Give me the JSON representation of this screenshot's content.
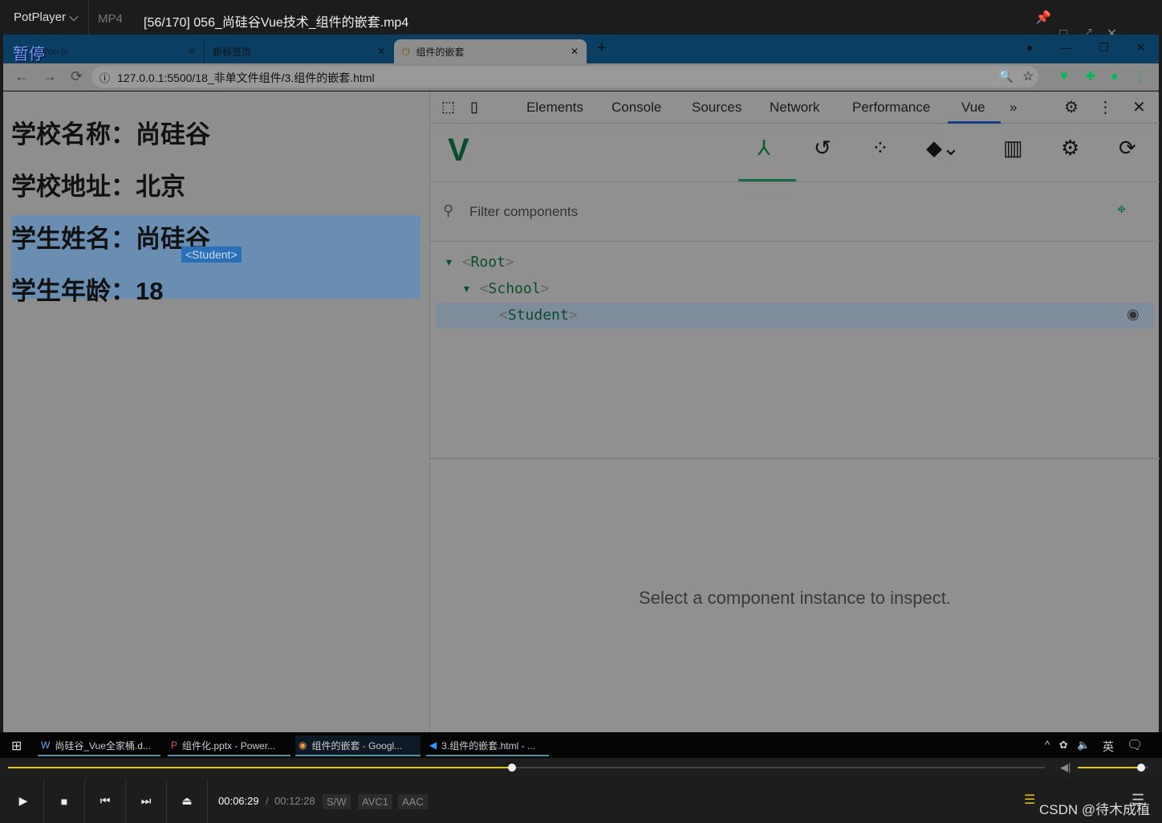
{
  "player": {
    "name": "PotPlayer",
    "format": "MP4",
    "title": "[56/170] 056_尚硅谷Vue技术_组件的嵌套.mp4",
    "pause_osd": "暂停",
    "time_current": "00:06:29",
    "time_sep": "/",
    "time_total": "00:12:28",
    "badges": [
      "S/W",
      "AVC1",
      "AAC"
    ],
    "progress_pct": 48.6,
    "volume_pct": 90,
    "watermark": "CSDN @待木成植"
  },
  "browser": {
    "tabs": [
      {
        "label": "Vue.js"
      },
      {
        "label": "新标签页"
      },
      {
        "label": "组件的嵌套",
        "active": true
      }
    ],
    "url": "127.0.0.1:5500/18_非单文件组件/3.组件的嵌套.html"
  },
  "page": {
    "lines": [
      "学校名称：尚硅谷",
      "学校地址：北京",
      "学生姓名：尚硅谷",
      "学生年龄：18"
    ],
    "tooltip": "<Student>"
  },
  "devtools": {
    "tabs": [
      "Elements",
      "Console",
      "Sources",
      "Network",
      "Performance",
      "Vue"
    ],
    "active_tab": "Vue",
    "filter_placeholder": "Filter components",
    "tree": [
      {
        "name": "Root",
        "depth": 0
      },
      {
        "name": "School",
        "depth": 1
      },
      {
        "name": "Student",
        "depth": 2,
        "selected": true
      }
    ],
    "empty_message": "Select a component instance to inspect.",
    "accent": "#0b6b3a"
  },
  "taskbar": {
    "items": [
      "尚硅谷_Vue全家桶.d...",
      "组件化.pptx - Power...",
      "组件的嵌套 - Googl...",
      "3.组件的嵌套.html - ..."
    ],
    "ime": "英"
  }
}
